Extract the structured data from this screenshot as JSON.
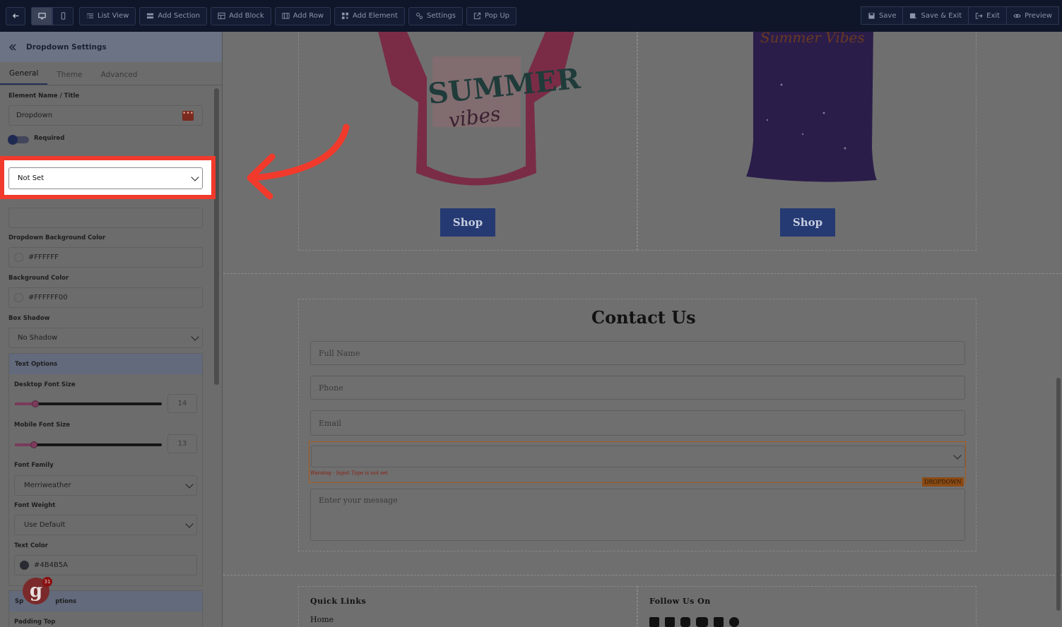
{
  "topbar": {
    "back_icon": "arrow-left-icon",
    "devices": [
      "desktop-icon",
      "mobile-icon"
    ],
    "buttons": [
      {
        "label": "List View",
        "icon": "list-icon"
      },
      {
        "label": "Add Section",
        "icon": "section-icon"
      },
      {
        "label": "Add Block",
        "icon": "block-icon"
      },
      {
        "label": "Add Row",
        "icon": "row-icon"
      },
      {
        "label": "Add Element",
        "icon": "element-icon"
      },
      {
        "label": "Settings",
        "icon": "settings-icon"
      },
      {
        "label": "Pop Up",
        "icon": "popup-icon"
      }
    ],
    "right_buttons": [
      {
        "label": "Save",
        "icon": "save-icon"
      },
      {
        "label": "Save & Exit",
        "icon": "save-exit-icon"
      },
      {
        "label": "Exit",
        "icon": "exit-icon"
      },
      {
        "label": "Preview",
        "icon": "eye-icon"
      }
    ]
  },
  "panel": {
    "title": "Dropdown Settings",
    "tabs": [
      "General",
      "Theme",
      "Advanced"
    ],
    "element_name_label": "Element Name / Title",
    "element_name_value": "Dropdown",
    "required_label": "Required",
    "input_type_value": "Not Set",
    "dropdown_bg_label": "Dropdown Background Color",
    "dropdown_bg_value": "#FFFFFF",
    "bg_color_label": "Background Color",
    "bg_color_value": "#FFFFFF00",
    "box_shadow_label": "Box Shadow",
    "box_shadow_value": "No Shadow",
    "text_options_label": "Text Options",
    "desktop_font_label": "Desktop Font Size",
    "desktop_font_value": "14",
    "desktop_font_fraction": 0.14,
    "mobile_font_label": "Mobile Font Size",
    "mobile_font_value": "13",
    "mobile_font_fraction": 0.13,
    "font_family_label": "Font Family",
    "font_family_value": "Merriweather",
    "font_weight_label": "Font Weight",
    "font_weight_value": "Use Default",
    "text_color_label": "Text Color",
    "text_color_value": "#4B4B5A",
    "spacing_label_start": "Sp",
    "spacing_label_end": "ptions",
    "padding_top_label": "Padding Top",
    "badge_count": "31"
  },
  "canvas": {
    "shop_left": "Shop",
    "shop_right": "Shop",
    "contact_title": "Contact Us",
    "full_name": "Full Name",
    "phone": "Phone",
    "email": "Email",
    "warning": "Warning - Input Type is not set",
    "dropdown_badge": "DROPDOWN",
    "message": "Enter your message",
    "quick_links": "Quick Links",
    "home": "Home",
    "follow_us": "Follow Us On",
    "social_icons": [
      "facebook-icon",
      "linkedin-icon",
      "instagram-icon",
      "youtube-icon",
      "twitter-icon",
      "google-icon"
    ]
  },
  "colors": {
    "highlight": "#f13a2c",
    "shop_button": "#253a73",
    "topbar": "#0f1629"
  }
}
